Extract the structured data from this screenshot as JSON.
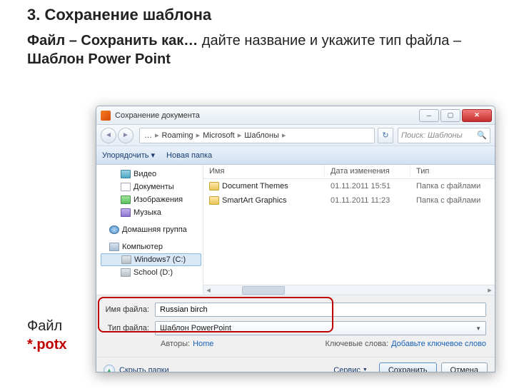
{
  "heading": "3. Сохранение шаблона",
  "instruction_parts": {
    "p1": "Файл – Сохранить как…",
    "p2": " дайте название и укажите тип файла – ",
    "p3": "Шаблон Power Point"
  },
  "file_label": "Файл",
  "file_ext": "*.potx",
  "dialog": {
    "title": "Сохранение документа",
    "nav": {
      "crumbs": [
        "…",
        "Roaming",
        "Microsoft",
        "Шаблоны"
      ],
      "search_placeholder": "Поиск: Шаблоны"
    },
    "toolbar": {
      "organize": "Упорядочить ▾",
      "new_folder": "Новая папка"
    },
    "tree": [
      {
        "label": "Видео",
        "icon": "vid",
        "lv": 2
      },
      {
        "label": "Документы",
        "icon": "doc",
        "lv": 2
      },
      {
        "label": "Изображения",
        "icon": "img",
        "lv": 2
      },
      {
        "label": "Музыка",
        "icon": "mus",
        "lv": 2
      },
      {
        "label": "",
        "icon": "",
        "lv": 0
      },
      {
        "label": "Домашняя группа",
        "icon": "net",
        "lv": 1
      },
      {
        "label": "",
        "icon": "",
        "lv": 0
      },
      {
        "label": "Компьютер",
        "icon": "pc",
        "lv": 1
      },
      {
        "label": "Windows7 (C:)",
        "icon": "drv",
        "lv": 2,
        "sel": true
      },
      {
        "label": "School (D:)",
        "icon": "drv",
        "lv": 2
      }
    ],
    "columns": {
      "name": "Имя",
      "date": "Дата изменения",
      "type": "Тип"
    },
    "files": [
      {
        "name": "Document Themes",
        "date": "01.11.2011 15:51",
        "type": "Папка с файлами"
      },
      {
        "name": "SmartArt Graphics",
        "date": "01.11.2011 11:23",
        "type": "Папка с файлами"
      }
    ],
    "form": {
      "name_label": "Имя файла:",
      "name_value": "Russian birch",
      "type_label": "Тип файла:",
      "type_value": "Шаблон PowerPoint",
      "authors_label": "Авторы:",
      "authors_value": "Home",
      "keywords_label": "Ключевые слова:",
      "keywords_value": "Добавьте ключевое слово"
    },
    "footer": {
      "hide_folders": "Скрыть папки",
      "service": "Сервис",
      "save": "Сохранить",
      "cancel": "Отмена"
    }
  }
}
